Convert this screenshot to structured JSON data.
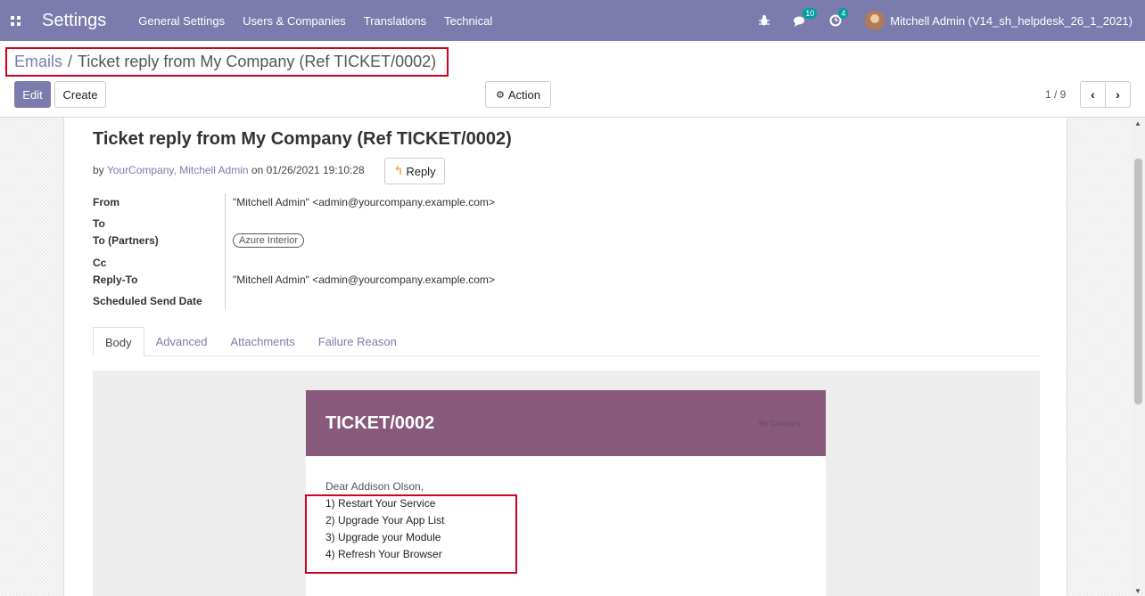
{
  "navbar": {
    "app_title": "Settings",
    "menu": [
      "General Settings",
      "Users & Companies",
      "Translations",
      "Technical"
    ],
    "messages_count": "10",
    "activities_count": "4",
    "user": "Mitchell Admin (V14_sh_helpdesk_26_1_2021)"
  },
  "breadcrumb": {
    "parent": "Emails",
    "separator": "/",
    "current": "Ticket reply from My Company (Ref TICKET/0002)"
  },
  "buttons": {
    "edit": "Edit",
    "create": "Create",
    "action": "Action",
    "reply": "Reply"
  },
  "pager": {
    "value": "1 / 9"
  },
  "record": {
    "subject": "Ticket reply from My Company (Ref TICKET/0002)",
    "by_prefix": "by",
    "author": "YourCompany, Mitchell Admin",
    "date_prefix": "on",
    "date": "01/26/2021 19:10:28",
    "fields": {
      "from_label": "From",
      "from_value": "\"Mitchell Admin\" <admin@yourcompany.example.com>",
      "to_label": "To",
      "to_partners_label": "To (Partners)",
      "to_partners_tag": "Azure Interior",
      "cc_label": "Cc",
      "reply_to_label": "Reply-To",
      "reply_to_value": "\"Mitchell Admin\" <admin@yourcompany.example.com>",
      "scheduled_label": "Scheduled Send Date"
    }
  },
  "tabs": [
    "Body",
    "Advanced",
    "Attachments",
    "Failure Reason"
  ],
  "email_body": {
    "ticket_ref": "TICKET/0002",
    "header_right": "My Company",
    "greeting": "Dear Addison Olson,",
    "steps": [
      "1) Restart Your Service",
      "2) Upgrade Your App List",
      "3) Upgrade your Module",
      "4) Refresh Your Browser"
    ]
  },
  "colors": {
    "brand": "#7c7bad",
    "email_header": "#875a7b",
    "highlight": "#d0021b"
  }
}
